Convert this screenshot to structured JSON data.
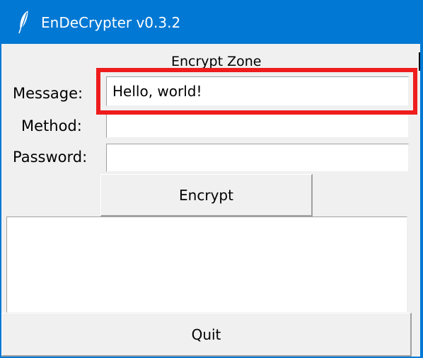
{
  "window": {
    "title": "EnDeCrypter v0.3.2",
    "icon": "feather-icon"
  },
  "zone": {
    "title": "Encrypt Zone"
  },
  "form": {
    "message_label": "Message:",
    "message_value": "Hello, world!",
    "method_label": "Method:",
    "method_value": "",
    "password_label": "Password:",
    "password_value": ""
  },
  "actions": {
    "encrypt_label": "Encrypt",
    "quit_label": "Quit"
  },
  "output": {
    "value": ""
  },
  "colors": {
    "titlebar": "#0078d4",
    "background": "#f0f0f0",
    "highlight": "#ee1c1c"
  }
}
